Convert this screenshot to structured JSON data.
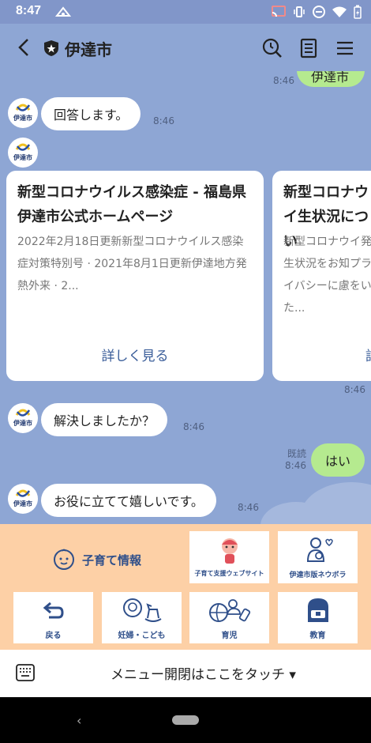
{
  "status": {
    "time": "8:47"
  },
  "header": {
    "title": "伊達市"
  },
  "avatar_text": "伊達市",
  "messages": {
    "outgoing_partial": {
      "text": "伊達市",
      "time": "8:46"
    },
    "reply_intro": {
      "text": "回答します。",
      "time": "8:46"
    },
    "cards": [
      {
        "title": "新型コロナウイルス感染症 - 福島県伊達市公式ホームページ",
        "description": "2022年2月18日更新新型コロナウイルス感染症対策特別号 · 2021年8月1日更新伊達地方発熱外来 · 2...",
        "link": "詳しく見る"
      },
      {
        "title": "新型コロナウイ生状況につい",
        "description": "新型コロナウイ発生状況をお知プライバシーに慮をいた...",
        "link": "詳"
      }
    ],
    "cards_time": "8:46",
    "question": {
      "text": "解決しましたか？",
      "time": "8:46"
    },
    "answer": {
      "text": "はい",
      "read": "既読",
      "time": "8:46"
    },
    "thanks": {
      "text": "お役に立てて嬉しいです。",
      "time": "8:46"
    }
  },
  "richmenu": {
    "info_label": "子育て情報",
    "tiles": [
      {
        "label": "子育て支援ウェブサイト"
      },
      {
        "label": "伊達市版ネウボラ"
      },
      {
        "label": "戻る"
      },
      {
        "label": "妊婦・こども"
      },
      {
        "label": "育児"
      },
      {
        "label": "教育"
      }
    ]
  },
  "menu_toggle": {
    "label": "メニュー開閉はここをタッチ ▾"
  },
  "colors": {
    "chat_bg": "#8ea6d4",
    "bubble_out": "#b5ea8f",
    "richmenu_bg": "#fdd0a6",
    "accent": "#2f4f8a"
  }
}
